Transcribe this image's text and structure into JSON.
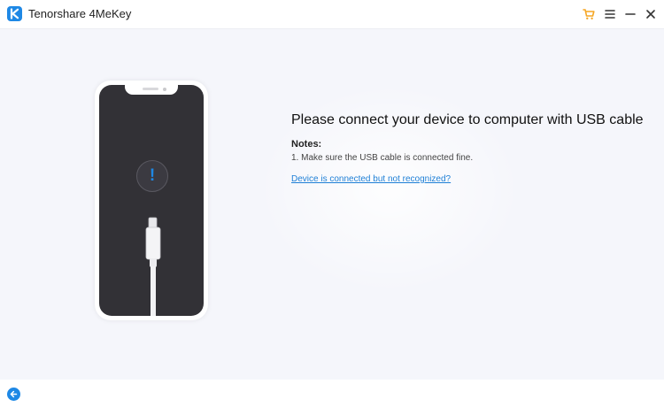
{
  "window": {
    "title": "Tenorshare 4MeKey",
    "controls": [
      {
        "name": "cart-icon",
        "color": "#f5a623"
      },
      {
        "name": "menu-icon"
      },
      {
        "name": "minimize-icon"
      },
      {
        "name": "close-icon"
      }
    ],
    "logo_icon": "tenorshare-k-logo",
    "accent_color": "#1e88e5"
  },
  "main": {
    "heading": "Please connect your device to computer with USB cable",
    "notes_title": "Notes:",
    "notes": [
      "1. Make sure the USB cable is connected fine."
    ],
    "help_link": "Device is connected but not recognized?",
    "illustration": {
      "device": "phone-icon",
      "alert_glyph": "!",
      "cable": "usb-cable-icon"
    }
  },
  "footer": {
    "back_icon": "back-arrow-icon"
  }
}
